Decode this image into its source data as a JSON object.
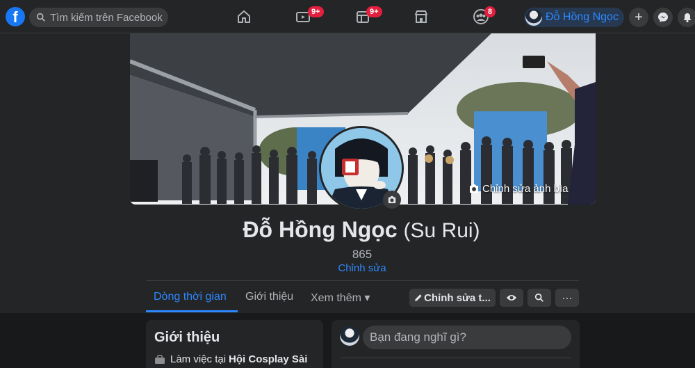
{
  "topbar": {
    "logo": "f",
    "search_placeholder": "Tìm kiếm trên Facebook",
    "nav": [
      {
        "icon": "home-icon",
        "badge": ""
      },
      {
        "icon": "watch-icon",
        "badge": "9+"
      },
      {
        "icon": "pages-icon",
        "badge": "9+"
      },
      {
        "icon": "marketplace-icon",
        "badge": ""
      },
      {
        "icon": "groups-icon",
        "badge": "8"
      }
    ],
    "profile_name": "Đỗ Hồng Ngọc",
    "buttons": [
      "plus-icon",
      "messenger-icon",
      "notifications-icon"
    ]
  },
  "profile": {
    "cover_edit_label": "Chỉnh sửa ảnh bìa",
    "name": "Đỗ Hồng Ngọc",
    "alt_name": "(Su Rui)",
    "friends_count": "865",
    "edit_label": "Chỉnh sửa"
  },
  "tabs": [
    {
      "label": "Dòng thời gian",
      "active": true
    },
    {
      "label": "Giới thiệu",
      "active": false
    },
    {
      "label": "Xem thêm ▾",
      "active": false
    }
  ],
  "actions": {
    "edit_profile": "Chỉnh sửa t...",
    "more": "···"
  },
  "intro": {
    "title": "Giới thiệu",
    "work_prefix": "Làm việc tại",
    "work_place": "Hội Cosplay Sài"
  },
  "composer": {
    "placeholder": "Bạn đang nghĩ gì?"
  },
  "colors": {
    "accent": "#2d88ff",
    "badge": "#e41e3f",
    "surface": "#242526",
    "background": "#18191a"
  }
}
